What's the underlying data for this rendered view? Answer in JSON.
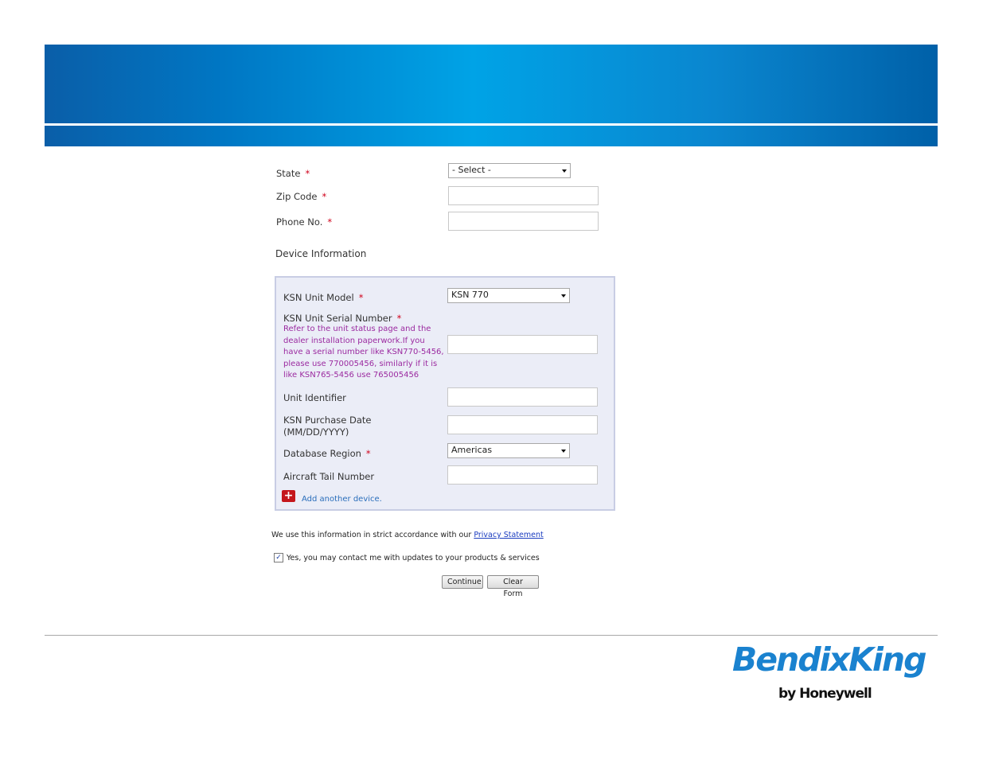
{
  "contact": {
    "state": {
      "label": "State",
      "required": "*",
      "value": "- Select -"
    },
    "zip": {
      "label": "Zip Code",
      "required": "*",
      "value": ""
    },
    "phone": {
      "label": "Phone No.",
      "required": "*",
      "value": ""
    }
  },
  "device": {
    "section_title": "Device Information",
    "unit_model": {
      "label": "KSN Unit Model",
      "required": "*",
      "value": "KSN 770"
    },
    "serial_number": {
      "label": "KSN Unit Serial Number",
      "required": "*",
      "note": "Refer to the unit status page and the dealer installation paperwork.If you have a serial number like KSN770-5456, please use 770005456, similarly if it is like KSN765-5456 use 765005456",
      "value": ""
    },
    "unit_identifier": {
      "label": "Unit Identifier",
      "value": ""
    },
    "purchase_date": {
      "label": "KSN Purchase Date (MM/DD/YYYY)",
      "value": ""
    },
    "database_region": {
      "label": "Database Region",
      "required": "*",
      "value": "Americas"
    },
    "tail_number": {
      "label": "Aircraft Tail Number",
      "value": ""
    },
    "add_device": "Add another device."
  },
  "privacy": {
    "text": "We use this information in strict accordance with our ",
    "link": "Privacy Statement"
  },
  "consent": {
    "label": "Yes, you may contact me with updates to your products & services",
    "checked": true
  },
  "buttons": {
    "continue": "Continue",
    "clear": "Clear Form"
  },
  "logo": {
    "brand": "BendixKing",
    "sub": "by Honeywell"
  },
  "colors": {
    "banner": "#0a86cf",
    "required": "#d0021b",
    "note": "#9b2aa0",
    "link": "#2a6ebb",
    "brand": "#1a82cf"
  },
  "icons": {
    "add": "plus-icon",
    "dropdown": "chevron-down-icon",
    "check": "check-icon"
  }
}
